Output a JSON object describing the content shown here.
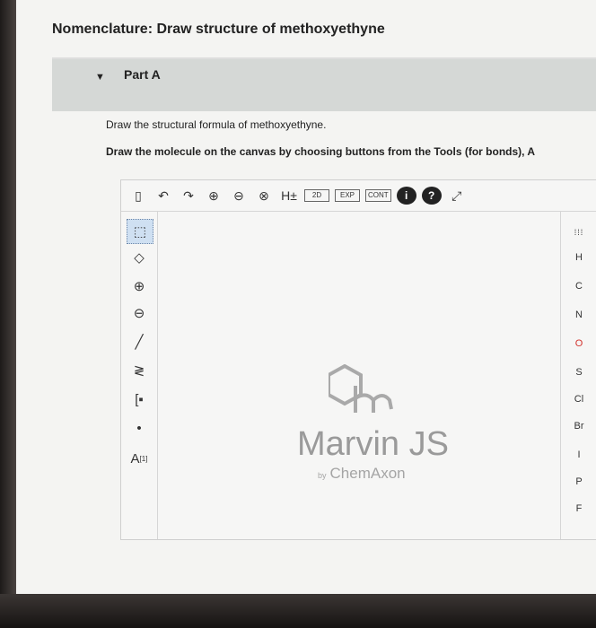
{
  "page": {
    "title": "Nomenclature: Draw structure of methoxyethyne",
    "part_label": "Part A",
    "instruction_1": "Draw the structural formula of methoxyethyne.",
    "instruction_2": "Draw the molecule on the canvas by choosing buttons from the Tools (for bonds), A"
  },
  "toolbar": {
    "h_toggle": "H±",
    "clean2d": "2D",
    "expand": "EXP",
    "contract": "CONT",
    "info": "i",
    "help": "?"
  },
  "left_tools": {
    "atom_map": "A",
    "atom_map_index": "[1]"
  },
  "elements": [
    "H",
    "C",
    "N",
    "O",
    "S",
    "Cl",
    "Br",
    "I",
    "P",
    "F"
  ],
  "logo": {
    "title": "Marvin JS",
    "by": "by",
    "company": "ChemAxon"
  }
}
